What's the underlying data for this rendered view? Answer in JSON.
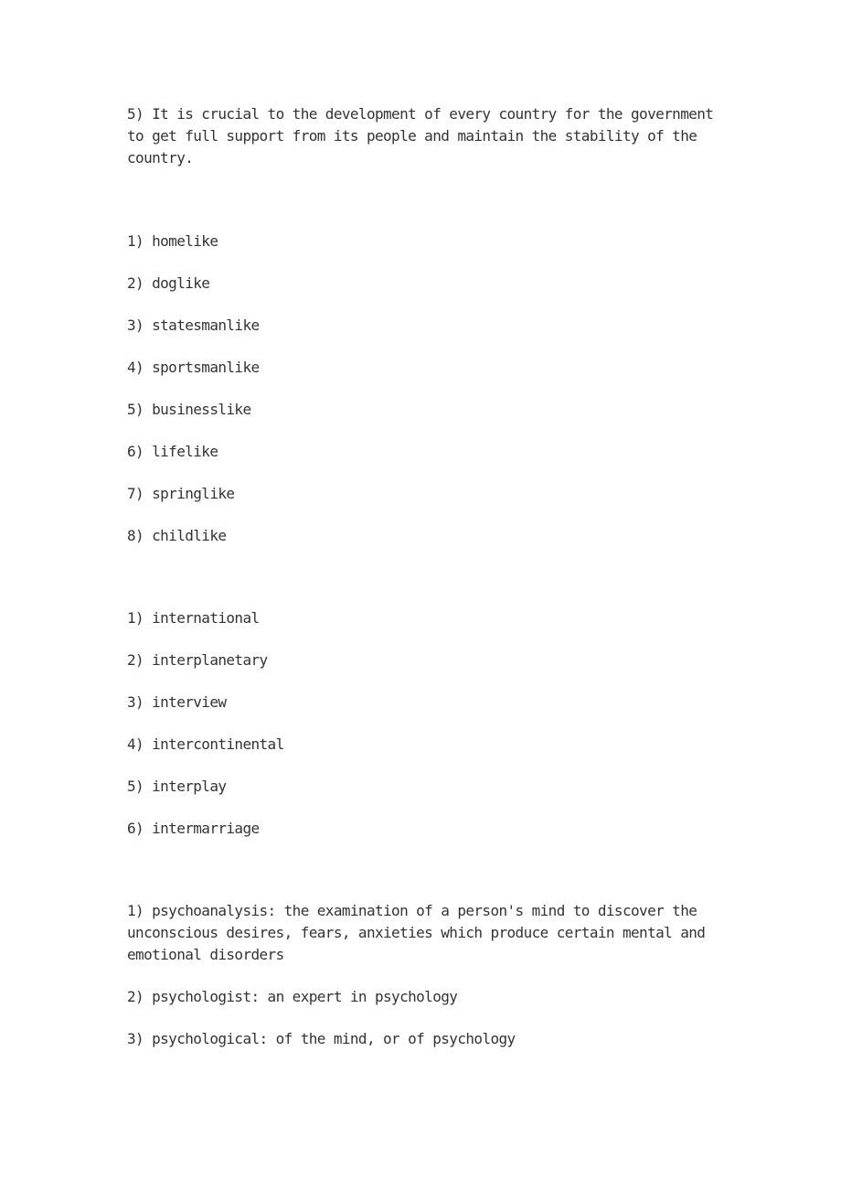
{
  "intro": {
    "lines": [
      "5) It is crucial to the development of every country for the government",
      "to get full support from its people and maintain the stability of the",
      "country."
    ]
  },
  "like_words": [
    "1) homelike",
    "2) doglike",
    "3) statesmanlike",
    "4) sportsmanlike",
    "5) businesslike",
    "6) lifelike",
    "7) springlike",
    "8) childlike"
  ],
  "inter_words": [
    "1) international",
    "2) interplanetary",
    "3) interview",
    "4) intercontinental",
    "5) interplay",
    "6) intermarriage"
  ],
  "psycho_definitions": {
    "item1_lines": [
      "1) psychoanalysis: the examination of a person's mind to discover the",
      "unconscious desires, fears, anxieties which produce certain mental and",
      "emotional disorders"
    ],
    "item2": "2) psychologist: an expert in psychology",
    "item3": "3) psychological: of the mind, or of psychology"
  }
}
